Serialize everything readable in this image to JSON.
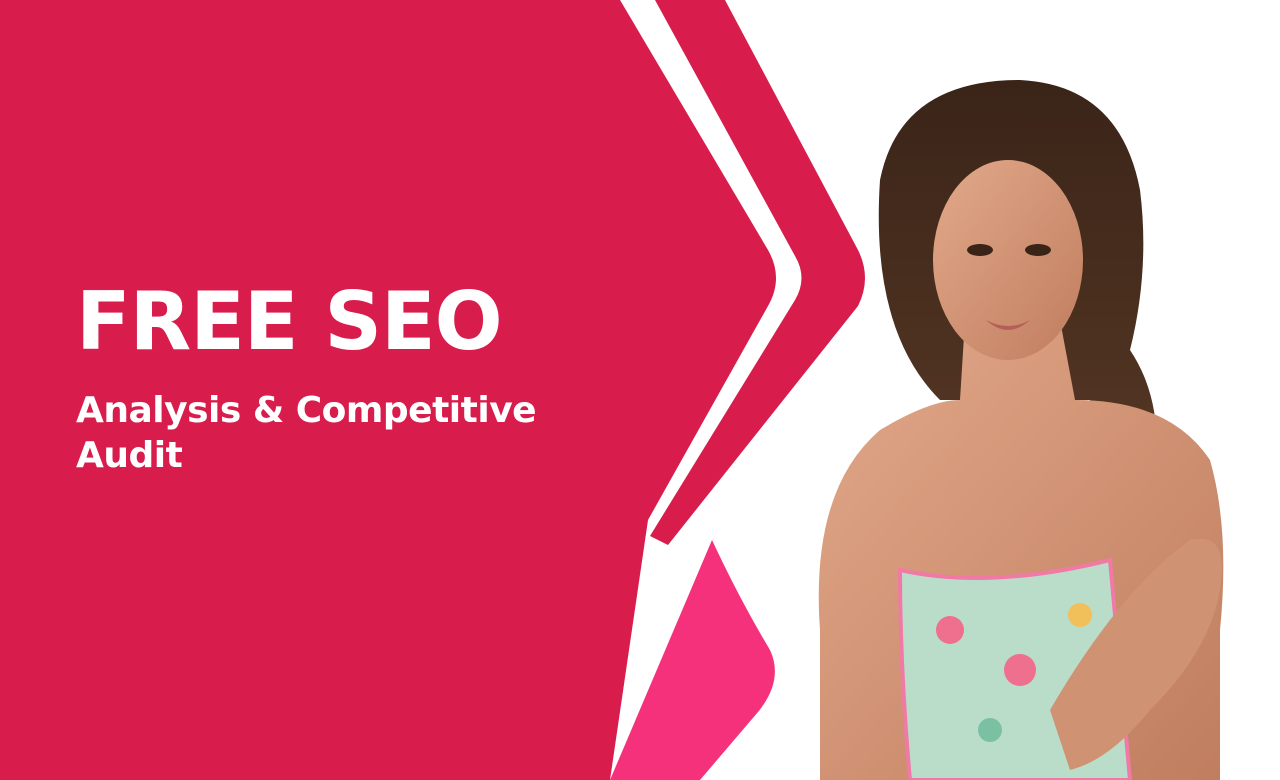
{
  "banner": {
    "headline": "FREE SEO",
    "subline_1": "Analysis & Competitive",
    "subline_2": "Audit"
  },
  "colors": {
    "primary_red": "#d81c4b",
    "accent_pink": "#f4317a",
    "background": "#ffffff",
    "text": "#ffffff"
  },
  "photo": {
    "subject": "woman-portrait"
  }
}
